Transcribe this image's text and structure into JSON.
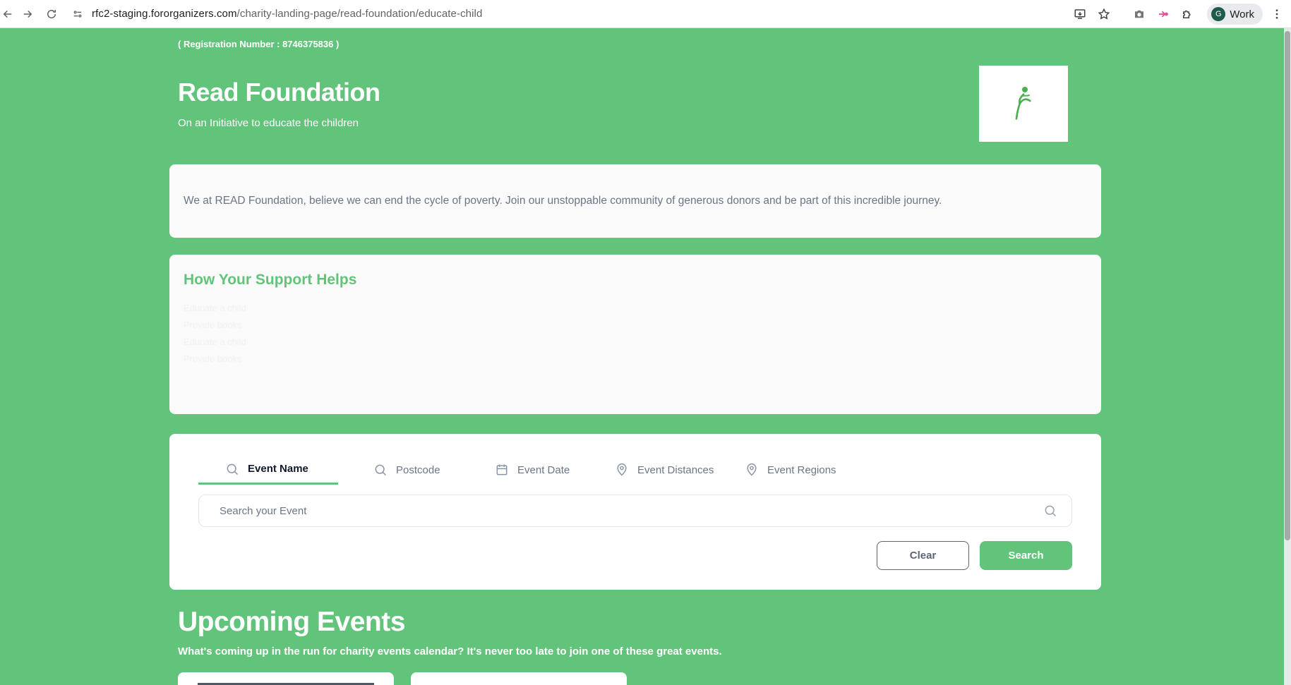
{
  "browser": {
    "url_host": "rfc2-staging.fororganizers.com",
    "url_path": "/charity-landing-page/read-foundation/educate-child",
    "profile_initial": "G",
    "profile_name": "Work"
  },
  "charity": {
    "registration": "( Registration Number : 8746375836 )",
    "name": "Read Foundation",
    "tagline": "On an Initiative to educate the children",
    "about": "We at READ Foundation, believe we can end the cycle of poverty. Join our unstoppable community of generous donors and be part of this incredible journey.",
    "brand_color": "#62c47a"
  },
  "support": {
    "title": "How Your Support Helps",
    "lines": [
      "Educate a child",
      "Provide books",
      "Educate a child",
      "Provide books"
    ]
  },
  "search": {
    "tabs": [
      {
        "label": "Event Name",
        "icon": "search-icon",
        "active": true
      },
      {
        "label": "Postcode",
        "icon": "search-icon",
        "active": false
      },
      {
        "label": "Event Date",
        "icon": "calendar-icon",
        "active": false
      },
      {
        "label": "Event Distances",
        "icon": "location-pin-icon",
        "active": false
      },
      {
        "label": "Event Regions",
        "icon": "location-pin-icon",
        "active": false
      }
    ],
    "placeholder": "Search your Event",
    "clear_label": "Clear",
    "search_label": "Search"
  },
  "events": {
    "title": "Upcoming Events",
    "subtitle": "What's coming up in the run for charity events calendar? It's never too late to join one of these great events."
  }
}
